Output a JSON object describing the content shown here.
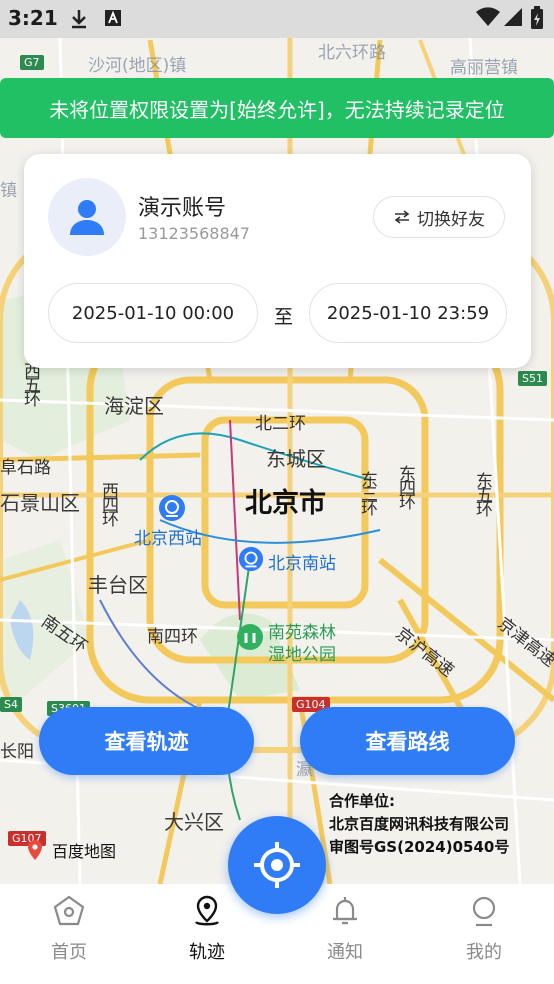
{
  "status_bar": {
    "time": "3:21"
  },
  "map": {
    "labels": {
      "shahe": "沙河(地区)镇",
      "north_sixth_ring": "北六环路",
      "gaoliying": "高丽营镇",
      "haidian": "海淀区",
      "north_second_ring": "北二环",
      "dongcheng": "东城区",
      "shijingshan_rd": "阜石路",
      "shijingshan": "石景山区",
      "west_fourth_ring": "西四环",
      "west_fifth_ring": "西五环",
      "beijing_city": "北京市",
      "east_third_ring": "东三环",
      "east_fourth_ring": "东四环",
      "east_fifth_ring": "东五环",
      "beijing_west_station": "北京西站",
      "beijing_south_station": "北京南站",
      "fengtai": "丰台区",
      "south_fifth_ring": "南五环",
      "south_fourth_ring": "南四环",
      "nanyuan_park_line1": "南苑森林",
      "nanyuan_park_line2": "湿地公园",
      "jinghu_expy": "京沪高速",
      "jingjin_expy": "京津高速",
      "changyang": "长阳",
      "daxing": "大兴区",
      "fading_left": "镇",
      "yizhuang": "瀛"
    },
    "shields": {
      "g7": "G7",
      "s51": "S51",
      "g104": "G104",
      "s3601": "S3601",
      "g107": "G107",
      "s4": "S4"
    }
  },
  "banner": {
    "text": "未将位置权限设置为[始终允许]，无法持续记录定位"
  },
  "account": {
    "name": "演示账号",
    "phone": "13123568847",
    "switch_label": "切换好友"
  },
  "date_range": {
    "start": "2025-01-10 00:00",
    "separator": "至",
    "end": "2025-01-10 23:59"
  },
  "actions": {
    "view_track": "查看轨迹",
    "view_route": "查看路线"
  },
  "attribution": {
    "line1": "合作单位:",
    "line2": "北京百度网讯科技有限公司",
    "line3": "审图号GS(2024)0540号",
    "logo": "百度地图"
  },
  "nav": {
    "items": [
      {
        "label": "首页",
        "icon": "home-icon"
      },
      {
        "label": "轨迹",
        "icon": "location-pin-icon"
      },
      {
        "label": "通知",
        "icon": "bell-icon"
      },
      {
        "label": "我的",
        "icon": "profile-icon"
      }
    ],
    "active_index": 1
  },
  "colors": {
    "accent": "#2f7cf6",
    "banner": "#22c065",
    "road_yellow": "#f3c95b"
  }
}
